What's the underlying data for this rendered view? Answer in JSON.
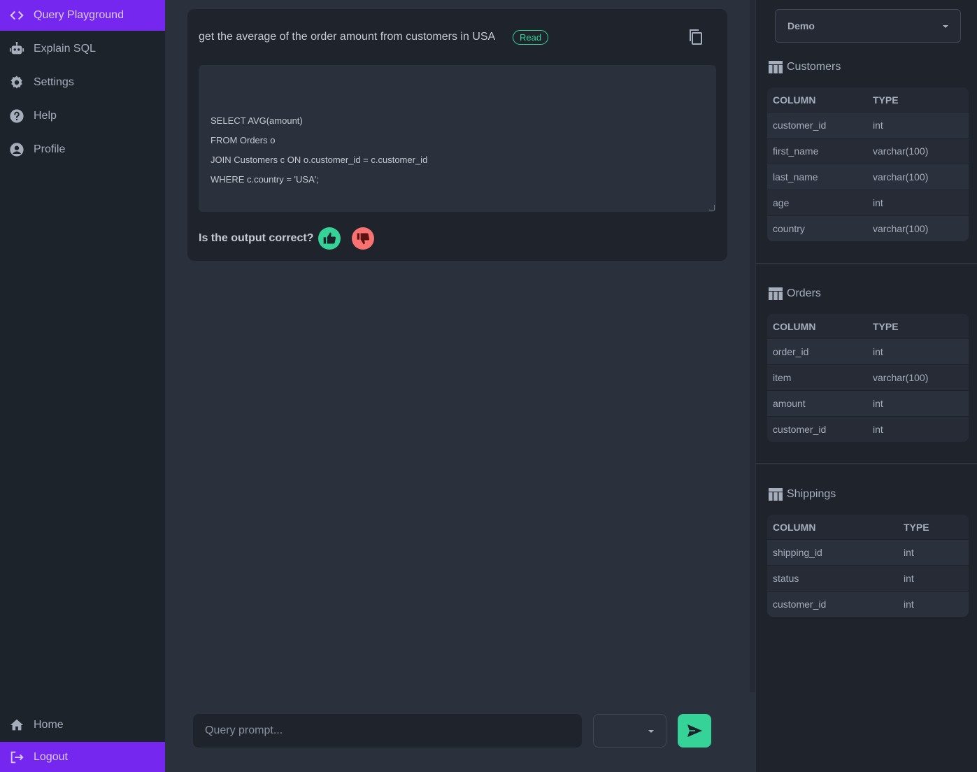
{
  "sidebar": {
    "top_items": [
      {
        "label": "Query Playground",
        "icon": "code-brackets-icon"
      },
      {
        "label": "Explain SQL",
        "icon": "robot-icon"
      },
      {
        "label": "Settings",
        "icon": "gear-icon"
      },
      {
        "label": "Help",
        "icon": "help-circle-icon"
      },
      {
        "label": "Profile",
        "icon": "user-circle-icon"
      }
    ],
    "bottom_items": [
      {
        "label": "Home",
        "icon": "home-icon"
      },
      {
        "label": "Logout",
        "icon": "logout-icon"
      }
    ]
  },
  "chat": {
    "prompt": "get the average of the order amount from customers in USA",
    "badge": "Read",
    "sql_lines": [
      "SELECT AVG(amount)",
      "FROM Orders o",
      "JOIN Customers c ON o.customer_id = c.customer_id",
      "WHERE c.country = 'USA';"
    ],
    "feedback_question": "Is the output correct?"
  },
  "input": {
    "placeholder": "Query prompt..."
  },
  "schema": {
    "database": "Demo",
    "tables": [
      {
        "name": "Customers",
        "headers": [
          "COLUMN",
          "TYPE"
        ],
        "rows": [
          [
            "customer_id",
            "int"
          ],
          [
            "first_name",
            "varchar(100)"
          ],
          [
            "last_name",
            "varchar(100)"
          ],
          [
            "age",
            "int"
          ],
          [
            "country",
            "varchar(100)"
          ]
        ]
      },
      {
        "name": "Orders",
        "headers": [
          "COLUMN",
          "TYPE"
        ],
        "rows": [
          [
            "order_id",
            "int"
          ],
          [
            "item",
            "varchar(100)"
          ],
          [
            "amount",
            "int"
          ],
          [
            "customer_id",
            "int"
          ]
        ]
      },
      {
        "name": "Shippings",
        "headers": [
          "COLUMN",
          "TYPE"
        ],
        "rows": [
          [
            "shipping_id",
            "int"
          ],
          [
            "status",
            "int"
          ],
          [
            "customer_id",
            "int"
          ]
        ]
      }
    ]
  },
  "colors": {
    "accent": "#7527f0",
    "success": "#36d399",
    "error": "#f87272"
  }
}
